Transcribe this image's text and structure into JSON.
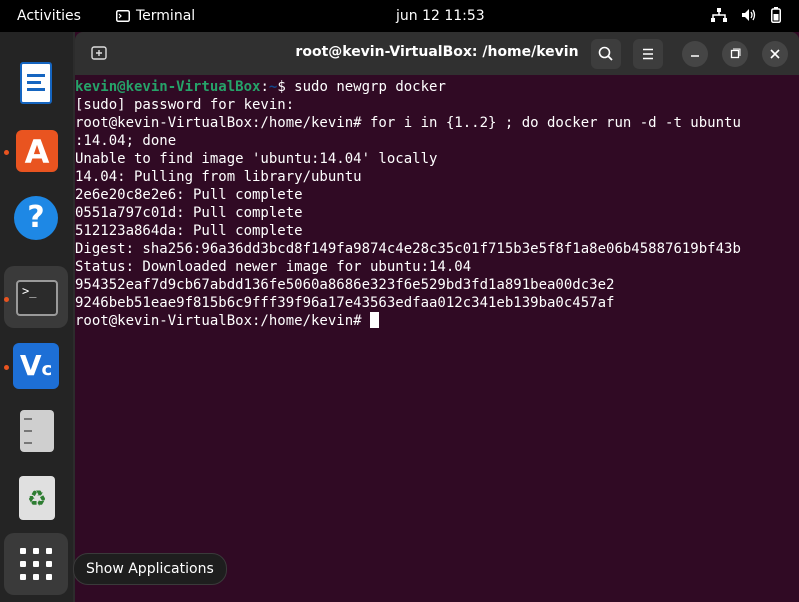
{
  "topbar": {
    "activities": "Activities",
    "app_name": "Terminal",
    "clock": "jun 12  11:53"
  },
  "window": {
    "title": "root@kevin-VirtualBox: /home/kevin"
  },
  "terminal": {
    "first_prompt_user": "kevin@kevin-VirtualBox",
    "first_prompt_sep": ":",
    "first_prompt_path": "~",
    "first_command": "$ sudo newgrp docker",
    "lines": [
      "[sudo] password for kevin:",
      "root@kevin-VirtualBox:/home/kevin# for i in {1..2} ; do docker run -d -t ubuntu",
      ":14.04; done",
      "Unable to find image 'ubuntu:14.04' locally",
      "14.04: Pulling from library/ubuntu",
      "2e6e20c8e2e6: Pull complete",
      "0551a797c01d: Pull complete",
      "512123a864da: Pull complete",
      "Digest: sha256:96a36dd3bcd8f149fa9874c4e28c35c01f715b3e5f8f1a8e06b45887619bf43b",
      "Status: Downloaded newer image for ubuntu:14.04",
      "954352eaf7d9cb67abdd136fe5060a8686e323f6e529bd3fd1a891bea00dc3e2",
      "9246beb51eae9f815b6c9fff39f96a17e43563edfaa012c341eb139ba0c457af"
    ],
    "last_prompt": "root@kevin-VirtualBox:/home/kevin# "
  },
  "tooltip": "Show Applications",
  "icons": {
    "network": "network-icon",
    "volume": "volume-icon",
    "battery": "battery-icon"
  },
  "colors": {
    "terminal_bg": "#300a24",
    "prompt_user": "#26a269",
    "prompt_path": "#12488b",
    "accent": "#e95420"
  }
}
